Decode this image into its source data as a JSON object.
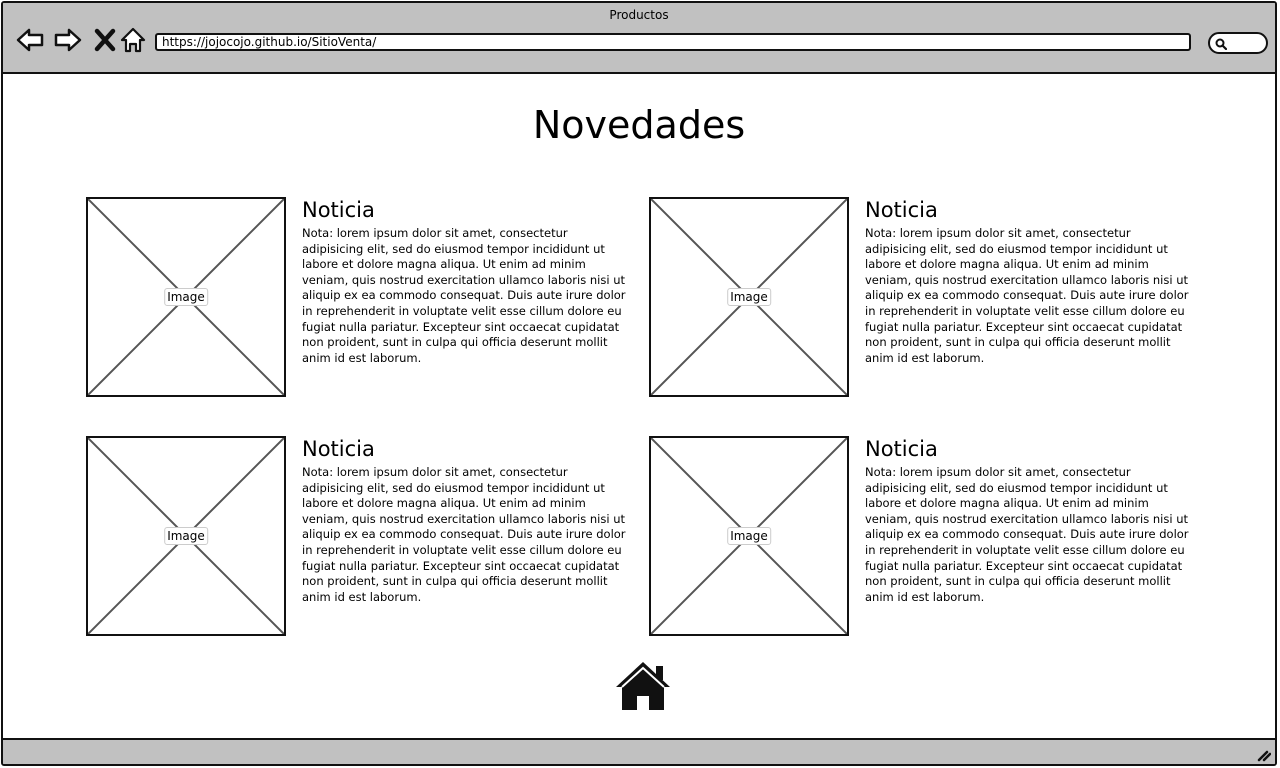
{
  "window": {
    "title": "Productos",
    "url": "https://jojocojo.github.io/SitioVenta/",
    "nav_icons": [
      "back-arrow-icon",
      "forward-arrow-icon",
      "close-x-icon",
      "home-icon"
    ],
    "search_icon": "search-icon"
  },
  "page": {
    "title": "Novedades",
    "footer_icon": "home-icon"
  },
  "cards": [
    {
      "image_label": "Image",
      "heading": "Noticia",
      "lines": [
        "Nota: lorem ipsum dolor sit amet, consectetur",
        "adipisicing elit, sed do eiusmod tempor incididunt ut",
        "labore et dolore magna aliqua. Ut enim ad minim",
        "veniam, quis nostrud exercitation ullamco laboris nisi ut",
        "aliquip ex ea commodo consequat. Duis aute irure dolor",
        "in reprehenderit in voluptate velit esse cillum dolore eu",
        "fugiat nulla pariatur. Excepteur sint occaecat cupidatat",
        "non proident, sunt in culpa qui officia deserunt mollit",
        "anim id est laborum."
      ]
    },
    {
      "image_label": "Image",
      "heading": "Noticia",
      "lines": [
        "Nota: lorem ipsum dolor sit amet, consectetur",
        "adipisicing elit, sed do eiusmod tempor incididunt ut",
        "labore et dolore magna aliqua. Ut enim ad minim",
        "veniam, quis nostrud exercitation ullamco laboris nisi ut",
        "aliquip ex ea commodo consequat. Duis aute irure dolor",
        "in reprehenderit in voluptate velit esse cillum dolore eu",
        "fugiat nulla pariatur. Excepteur sint occaecat cupidatat",
        "non proident, sunt in culpa qui officia deserunt mollit",
        "anim id est laborum."
      ]
    },
    {
      "image_label": "Image",
      "heading": "Noticia",
      "lines": [
        "Nota: lorem ipsum dolor sit amet, consectetur",
        "adipisicing elit, sed do eiusmod tempor incididunt ut",
        "labore et dolore magna aliqua. Ut enim ad minim",
        "veniam, quis nostrud exercitation ullamco laboris nisi ut",
        "aliquip ex ea commodo consequat. Duis aute irure dolor",
        "in reprehenderit in voluptate velit esse cillum dolore eu",
        "fugiat nulla pariatur. Excepteur sint occaecat cupidatat",
        "non proident, sunt in culpa qui officia deserunt mollit",
        "anim id est laborum."
      ]
    },
    {
      "image_label": "Image",
      "heading": "Noticia",
      "lines": [
        "Nota: lorem ipsum dolor sit amet, consectetur",
        "adipisicing elit, sed do eiusmod tempor incididunt ut",
        "labore et dolore magna aliqua. Ut enim ad minim",
        "veniam, quis nostrud exercitation ullamco laboris nisi ut",
        "aliquip ex ea commodo consequat. Duis aute irure dolor",
        "in reprehenderit in voluptate velit esse cillum dolore eu",
        "fugiat nulla pariatur. Excepteur sint occaecat cupidatat",
        "non proident, sunt in culpa qui officia deserunt mollit",
        "anim id est laborum."
      ]
    }
  ]
}
